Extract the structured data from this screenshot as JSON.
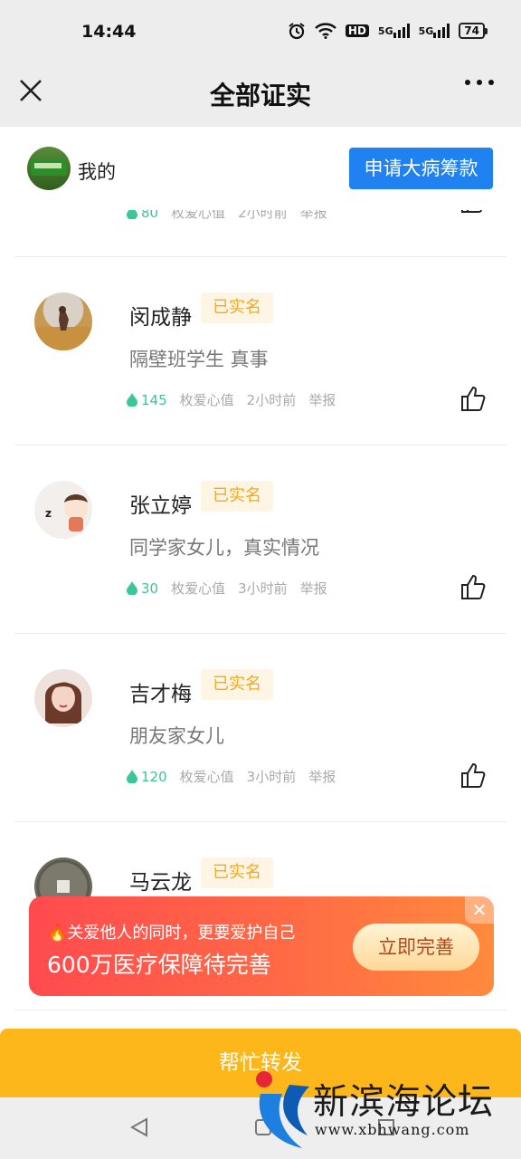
{
  "status_bar": {
    "time": "14:44",
    "hd": "HD",
    "net1": "5G",
    "net2": "5G",
    "battery": "74"
  },
  "nav": {
    "title": "全部证实"
  },
  "my_bar": {
    "label": "我的",
    "apply_button": "申请大病筹款"
  },
  "partial_item": {
    "hearts": "80",
    "unit": "枚爱心值",
    "time": "2小时前",
    "report": "举报"
  },
  "items": [
    {
      "name": "闵成静",
      "badge": "已实名",
      "message": "隔壁班学生 真事",
      "hearts": "145",
      "unit": "枚爱心值",
      "time": "2小时前",
      "report": "举报"
    },
    {
      "name": "张立婷",
      "badge": "已实名",
      "message": "同学家女儿，真实情况",
      "hearts": "30",
      "unit": "枚爱心值",
      "time": "3小时前",
      "report": "举报"
    },
    {
      "name": "吉才梅",
      "badge": "已实名",
      "message": "朋友家女儿",
      "hearts": "120",
      "unit": "枚爱心值",
      "time": "3小时前",
      "report": "举报"
    },
    {
      "name": "马云龙",
      "badge": "已实名"
    }
  ],
  "promo": {
    "line1": "关爱他人的同时，更要爱护自己",
    "line2": "600万医疗保障待完善",
    "button": "立即完善"
  },
  "cta": {
    "label": "帮忙转发"
  },
  "watermark": {
    "name": "新滨海论坛",
    "url": "www.xbhwang.com"
  }
}
